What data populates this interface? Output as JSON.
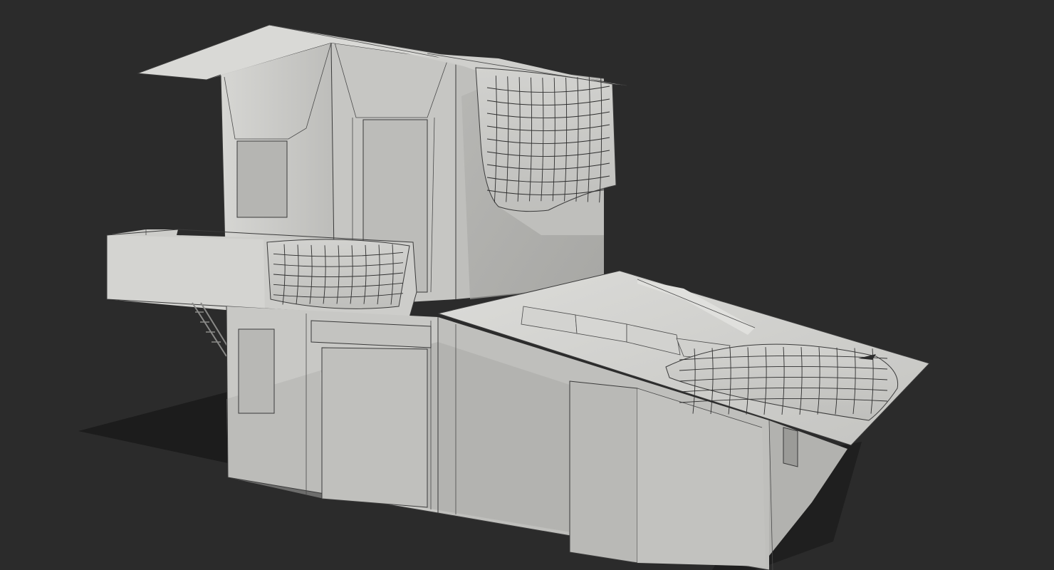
{
  "scene": {
    "background_color": "#2b2b2b",
    "model_color": "#c9c9c6",
    "wire_color": "#3a3a3a"
  }
}
